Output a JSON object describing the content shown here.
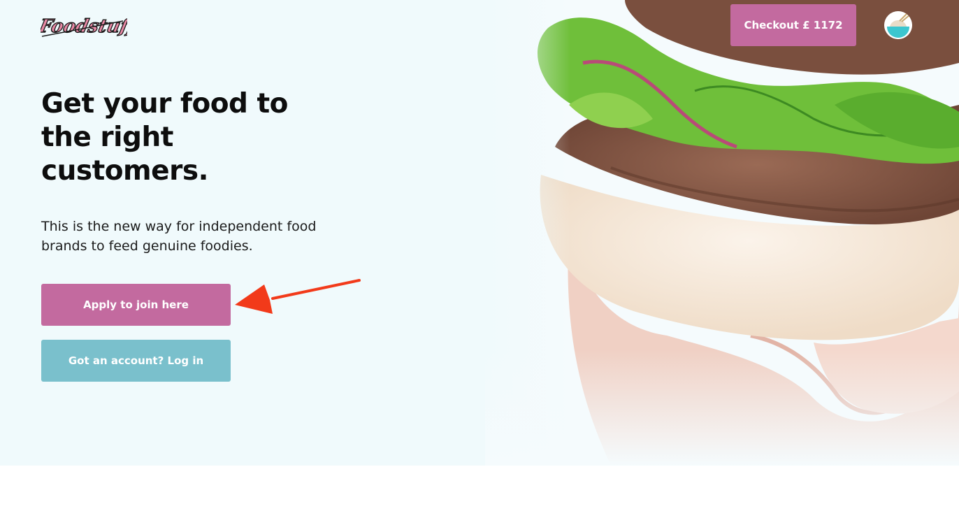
{
  "brand": {
    "logo_text": "Foodstuff"
  },
  "header": {
    "checkout_label": "Checkout £ 1172",
    "avatar_icon": "food-bowl-icon"
  },
  "hero": {
    "headline": "Get your food to the right customers.",
    "subtitle": "This is the new way for independent food brands to feed genuine foodies.",
    "apply_label": "Apply to join here",
    "login_label": "Got an account? Log in",
    "image": "burger-photo"
  },
  "annotation": {
    "icon": "red-arrow-icon",
    "color": "#f23a1a"
  },
  "colors": {
    "hero_bg": "#f0fafc",
    "primary": "#c36a9f",
    "secondary": "#7ac0cc",
    "text": "#0d0d0d"
  }
}
